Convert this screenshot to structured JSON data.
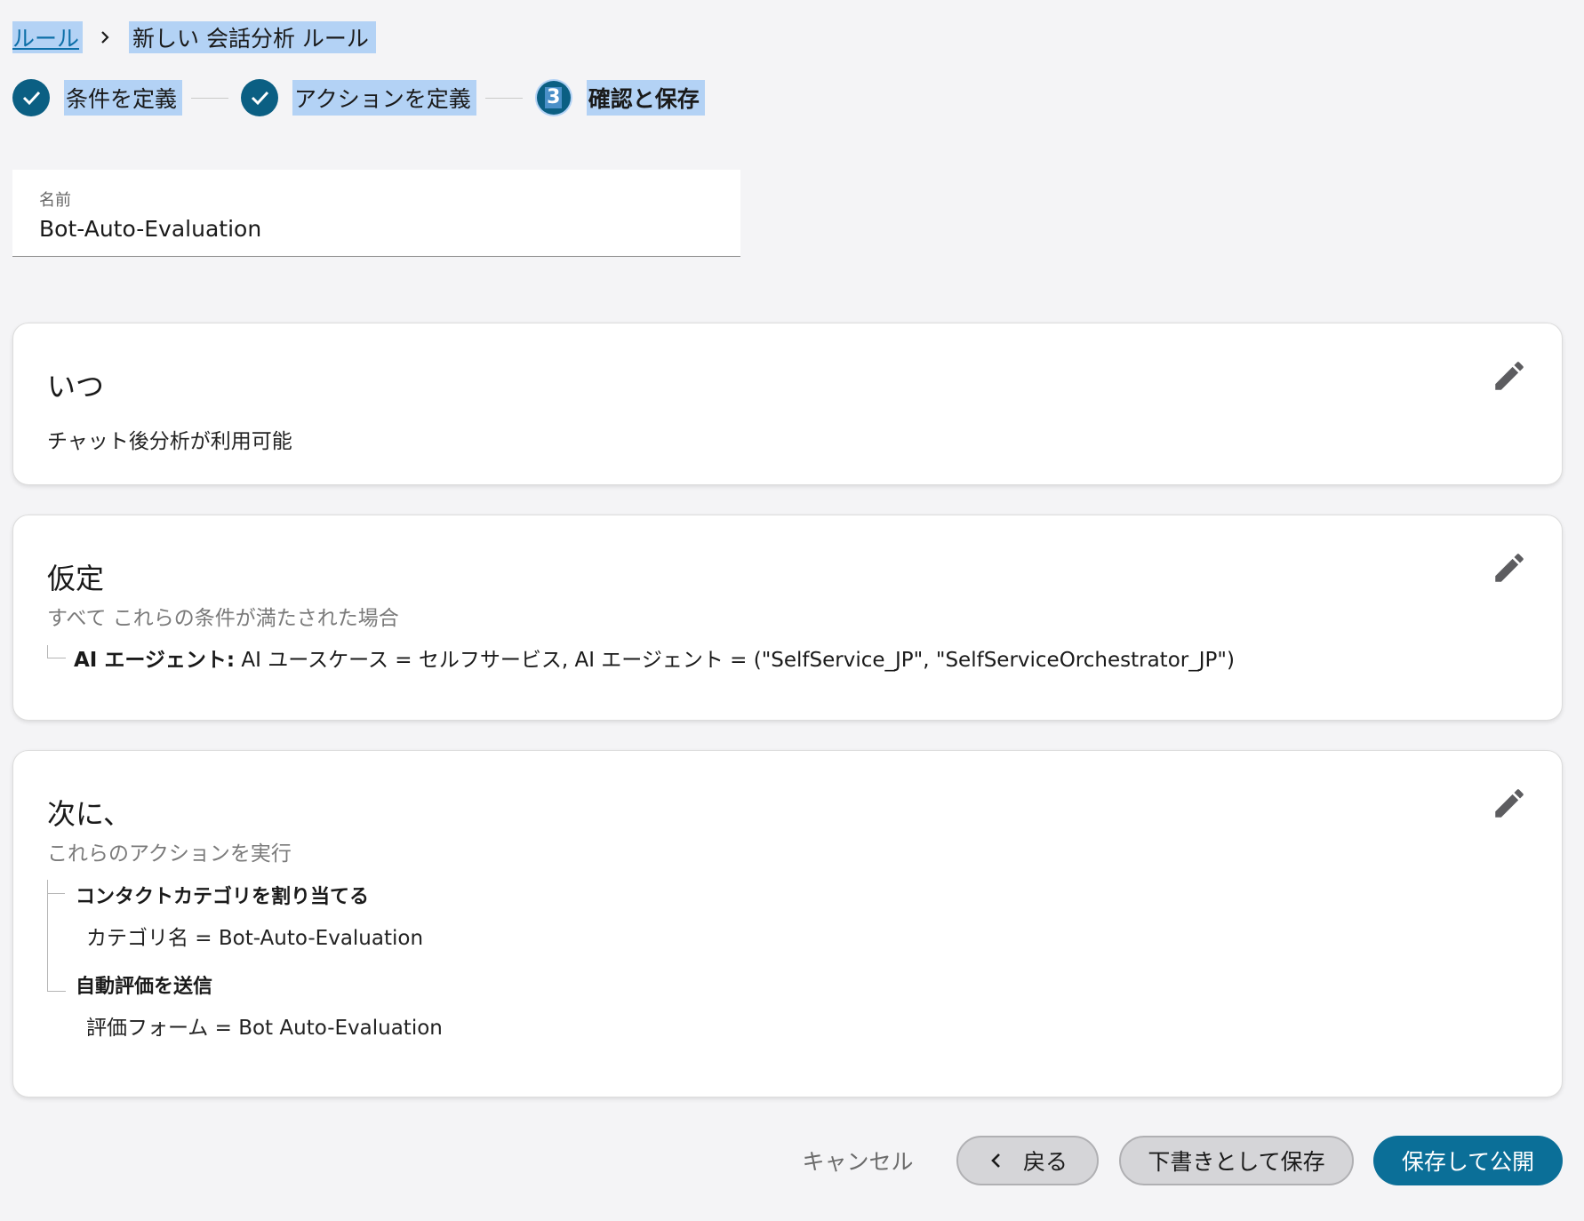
{
  "breadcrumb": {
    "rules_link": "ルール",
    "current": "新しい 会話分析 ルール"
  },
  "stepper": {
    "steps": [
      {
        "label": "条件を定義",
        "state": "complete"
      },
      {
        "label": "アクションを定義",
        "state": "complete"
      },
      {
        "label": "確認と保存",
        "state": "active",
        "number": "3"
      }
    ]
  },
  "name_field": {
    "label": "名前",
    "value": "Bot-Auto-Evaluation"
  },
  "when_card": {
    "title": "いつ",
    "text": "チャット後分析が利用可能"
  },
  "condition_card": {
    "title": "仮定",
    "subtitle": "すべて これらの条件が満たされた場合",
    "key": "AI エージェント:",
    "value": " AI ユースケース = セルフサービス, AI エージェント = (\"SelfService_JP\", \"SelfServiceOrchestrator_JP\")"
  },
  "action_card": {
    "title": "次に、",
    "subtitle": "これらのアクションを実行",
    "actions": [
      {
        "title": "コンタクトカテゴリを割り当てる",
        "detail": "カテゴリ名 = Bot-Auto-Evaluation"
      },
      {
        "title": "自動評価を送信",
        "detail": "評価フォーム = Bot Auto-Evaluation"
      }
    ]
  },
  "footer": {
    "cancel": "キャンセル",
    "back": "戻る",
    "save_draft": "下書きとして保存",
    "save_publish": "保存して公開"
  },
  "colors": {
    "accent": "#0b6f98",
    "step_circle": "#0b5f83",
    "selection": "#b3d2f5",
    "background": "#f4f4f6"
  },
  "icons": {
    "breadcrumb_separator": "chevron-right-icon",
    "step_complete": "check-icon",
    "edit": "pencil-icon",
    "back": "chevron-left-icon"
  }
}
